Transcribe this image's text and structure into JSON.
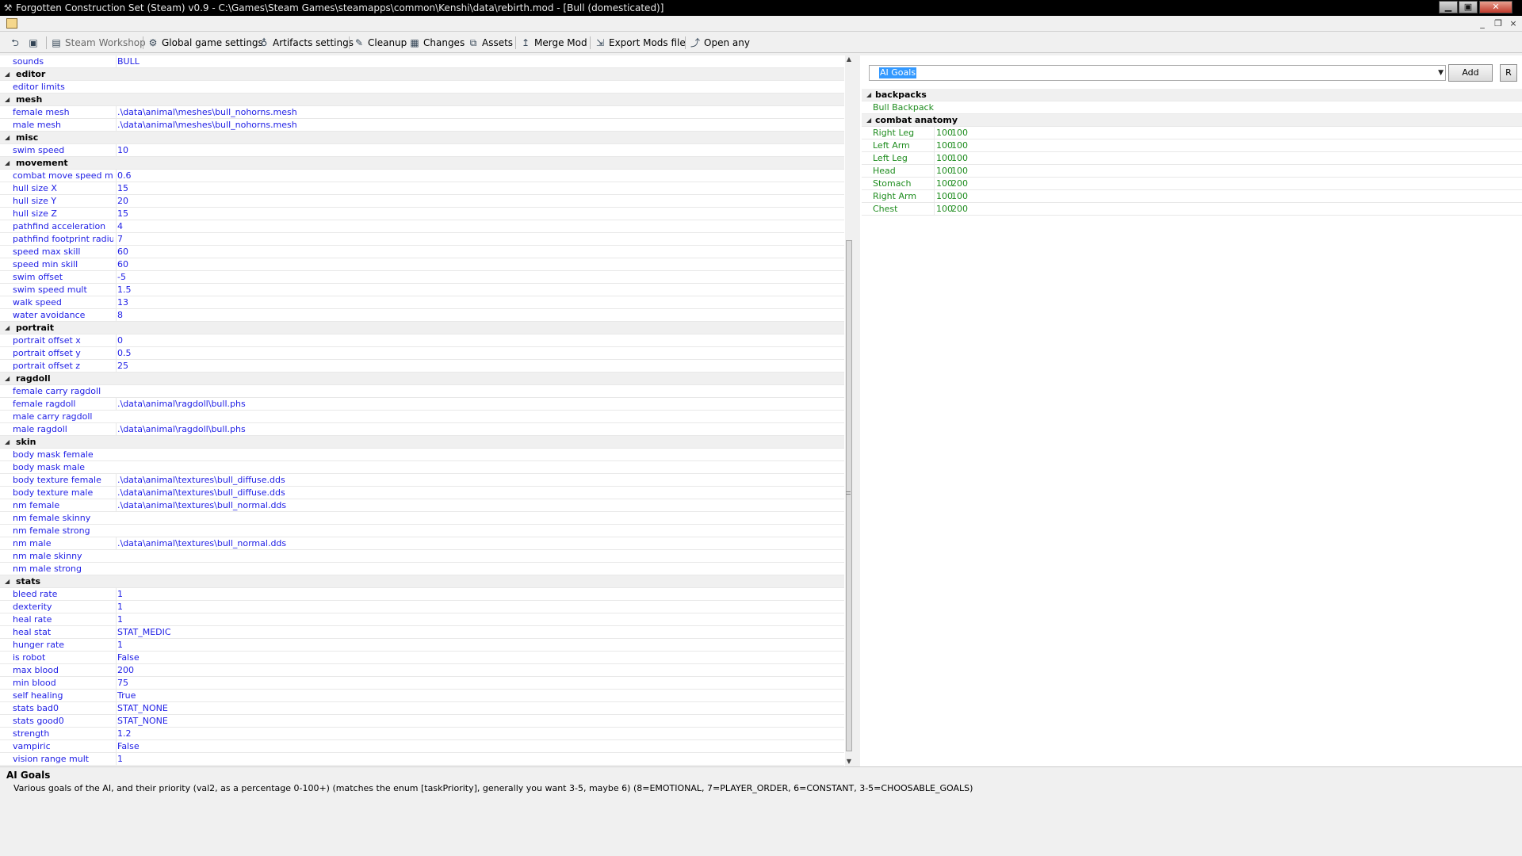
{
  "window": {
    "title": "Forgotten Construction Set (Steam) v0.9 - C:\\Games\\Steam Games\\steamapps\\common\\Kenshi\\data\\rebirth.mod - [Bull (domesticated)]",
    "app_icon": "hammer-icon",
    "buttons": {
      "minimize": "▁",
      "maximize": "▣",
      "close": "✕"
    },
    "mdi_buttons": {
      "minimize": "_",
      "restore": "❐",
      "close": "×"
    }
  },
  "toolbar": {
    "items": [
      {
        "label": "",
        "icon": "open-icon"
      },
      {
        "label": "",
        "icon": "save-icon"
      },
      {
        "label": "Steam Workshop",
        "icon": "workshop-icon"
      },
      {
        "label": "Global game settings",
        "icon": "gear-icon"
      },
      {
        "label": "Artifacts settings",
        "icon": "artifact-icon"
      },
      {
        "label": "Cleanup",
        "icon": "broom-icon"
      },
      {
        "label": "Changes",
        "icon": "changes-icon"
      },
      {
        "label": "Assets",
        "icon": "assets-icon"
      },
      {
        "label": "Merge Mod",
        "icon": "merge-icon"
      },
      {
        "label": "Export Mods file",
        "icon": "export-icon"
      },
      {
        "label": "Open any",
        "icon": "open-any-icon"
      }
    ]
  },
  "properties": [
    {
      "k": "sounds",
      "v": "BULL"
    },
    {
      "cat": "editor"
    },
    {
      "k": "editor limits",
      "v": ""
    },
    {
      "cat": "mesh"
    },
    {
      "k": "female mesh",
      "v": ".\\data\\animal\\meshes\\bull_nohorns.mesh"
    },
    {
      "k": "male mesh",
      "v": ".\\data\\animal\\meshes\\bull_nohorns.mesh"
    },
    {
      "cat": "misc"
    },
    {
      "k": "swim speed",
      "v": "10"
    },
    {
      "cat": "movement"
    },
    {
      "k": "combat move speed mult",
      "v": "0.6"
    },
    {
      "k": "hull size X",
      "v": "15"
    },
    {
      "k": "hull size Y",
      "v": "20"
    },
    {
      "k": "hull size Z",
      "v": "15"
    },
    {
      "k": "pathfind acceleration",
      "v": "4"
    },
    {
      "k": "pathfind footprint radius",
      "v": "7"
    },
    {
      "k": "speed max skill",
      "v": "60"
    },
    {
      "k": "speed min skill",
      "v": "60"
    },
    {
      "k": "swim offset",
      "v": "-5"
    },
    {
      "k": "swim speed mult",
      "v": "1.5"
    },
    {
      "k": "walk speed",
      "v": "13"
    },
    {
      "k": "water avoidance",
      "v": "8"
    },
    {
      "cat": "portrait"
    },
    {
      "k": "portrait offset x",
      "v": "0"
    },
    {
      "k": "portrait offset y",
      "v": "0.5"
    },
    {
      "k": "portrait offset z",
      "v": "25"
    },
    {
      "cat": "ragdoll"
    },
    {
      "k": "female carry ragdoll",
      "v": ""
    },
    {
      "k": "female ragdoll",
      "v": ".\\data\\animal\\ragdoll\\bull.phs"
    },
    {
      "k": "male carry ragdoll",
      "v": ""
    },
    {
      "k": "male ragdoll",
      "v": ".\\data\\animal\\ragdoll\\bull.phs"
    },
    {
      "cat": "skin"
    },
    {
      "k": "body mask female",
      "v": ""
    },
    {
      "k": "body mask male",
      "v": ""
    },
    {
      "k": "body texture female",
      "v": ".\\data\\animal\\textures\\bull_diffuse.dds"
    },
    {
      "k": "body texture male",
      "v": ".\\data\\animal\\textures\\bull_diffuse.dds"
    },
    {
      "k": "nm female",
      "v": ".\\data\\animal\\textures\\bull_normal.dds"
    },
    {
      "k": "nm female skinny",
      "v": ""
    },
    {
      "k": "nm female strong",
      "v": ""
    },
    {
      "k": "nm male",
      "v": ".\\data\\animal\\textures\\bull_normal.dds"
    },
    {
      "k": "nm male skinny",
      "v": ""
    },
    {
      "k": "nm male strong",
      "v": ""
    },
    {
      "cat": "stats"
    },
    {
      "k": "bleed rate",
      "v": "1"
    },
    {
      "k": "dexterity",
      "v": "1"
    },
    {
      "k": "heal rate",
      "v": "1"
    },
    {
      "k": "heal stat",
      "v": "STAT_MEDIC"
    },
    {
      "k": "hunger rate",
      "v": "1"
    },
    {
      "k": "is robot",
      "v": "False"
    },
    {
      "k": "max blood",
      "v": "200"
    },
    {
      "k": "min blood",
      "v": "75"
    },
    {
      "k": "self healing",
      "v": "True"
    },
    {
      "k": "stats bad0",
      "v": "STAT_NONE"
    },
    {
      "k": "stats good0",
      "v": "STAT_NONE"
    },
    {
      "k": "strength",
      "v": "1.2"
    },
    {
      "k": "vampiric",
      "v": "False"
    },
    {
      "k": "vision range mult",
      "v": "1"
    }
  ],
  "right": {
    "select_value": "AI Goals",
    "add_label": "Add",
    "r_label": "R",
    "rows": [
      {
        "cat": "backpacks"
      },
      {
        "k": "Bull Backpack",
        "v1": "",
        "v2": ""
      },
      {
        "cat": "combat anatomy"
      },
      {
        "k": "Right Leg",
        "v1": "100",
        "v2": "100"
      },
      {
        "k": "Left Arm",
        "v1": "100",
        "v2": "100"
      },
      {
        "k": "Left Leg",
        "v1": "100",
        "v2": "100"
      },
      {
        "k": "Head",
        "v1": "100",
        "v2": "100"
      },
      {
        "k": "Stomach",
        "v1": "100",
        "v2": "200"
      },
      {
        "k": "Right Arm",
        "v1": "100",
        "v2": "100"
      },
      {
        "k": "Chest",
        "v1": "100",
        "v2": "200"
      }
    ]
  },
  "description": {
    "title": "AI Goals",
    "text": "Various goals of the AI, and their priority (val2, as a percentage 0-100+) (matches the enum [taskPriority], generally you want 3-5, maybe 6) (8=EMOTIONAL, 7=PLAYER_ORDER, 6=CONSTANT, 3-5=CHOOSABLE_GOALS)"
  },
  "colors": {
    "value_text": "#1e1ee6",
    "list_text": "#1e8c1e",
    "selection": "#3399ff"
  }
}
